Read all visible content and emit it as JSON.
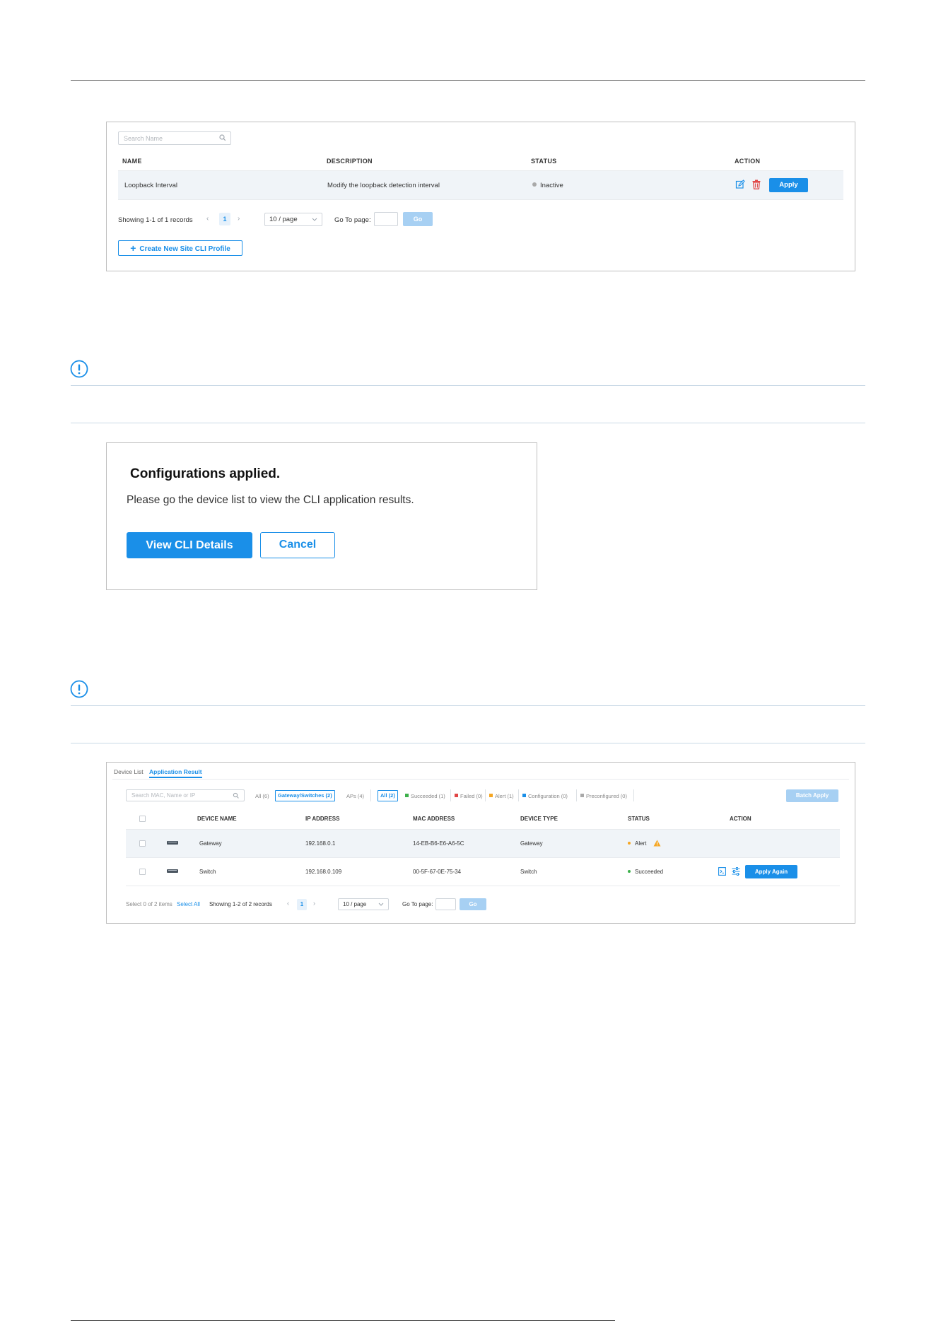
{
  "colors": {
    "accent": "#1a8fe8",
    "accent_light": "#a7d0f3",
    "danger": "#e14545",
    "success": "#3cb04a",
    "warning": "#f5a623",
    "inactive": "#a9a9a9",
    "configuration": "#1a8fe8"
  },
  "profiles_panel": {
    "search_placeholder": "Search Name",
    "columns": {
      "name": "NAME",
      "description": "DESCRIPTION",
      "status": "STATUS",
      "action": "ACTION"
    },
    "rows": [
      {
        "name": "Loopback Interval",
        "description": "Modify the loopback detection interval",
        "status": "Inactive",
        "apply_label": "Apply"
      }
    ],
    "pagination": {
      "showing": "Showing 1-1 of 1 records",
      "prev": "‹",
      "current_page": "1",
      "next": "›",
      "page_size": "10 / page",
      "goto_label": "Go To page:",
      "goto_value": "",
      "go_label": "Go"
    },
    "create_button": "Create New Site CLI Profile"
  },
  "dialog": {
    "title": "Configurations applied.",
    "message": "Please go the device list to view the CLI application results.",
    "primary_label": "View CLI Details",
    "secondary_label": "Cancel"
  },
  "results_panel": {
    "tabs": [
      "Device List",
      "Application Result"
    ],
    "active_tab": "Application Result",
    "search_placeholder": "Search MAC, Name or IP",
    "type_filters": [
      "All (6)",
      "Gateway/Switches (2)",
      "APs (4)"
    ],
    "status_filters": [
      {
        "label": "All (2)",
        "color": ""
      },
      {
        "label": "Succeeded (1)",
        "color": "#3cb04a"
      },
      {
        "label": "Failed (0)",
        "color": "#e14545"
      },
      {
        "label": "Alert (1)",
        "color": "#f5a623"
      },
      {
        "label": "Configuration (0)",
        "color": "#1a8fe8"
      },
      {
        "label": "Preconfigured (0)",
        "color": "#a9a9a9"
      }
    ],
    "batch_apply": "Batch Apply",
    "columns": {
      "device_name": "DEVICE NAME",
      "ip_address": "IP ADDRESS",
      "mac_address": "MAC ADDRESS",
      "device_type": "DEVICE TYPE",
      "status": "STATUS",
      "action": "ACTION"
    },
    "rows": [
      {
        "device_name": "Gateway",
        "ip": "192.168.0.1",
        "mac": "14-EB-B6-E6-A6-5C",
        "type": "Gateway",
        "status": "Alert",
        "status_color": "#f5a623"
      },
      {
        "device_name": "Switch",
        "ip": "192.168.0.109",
        "mac": "00-5F-67-0E-75-34",
        "type": "Switch",
        "status": "Succeeded",
        "status_color": "#3cb04a",
        "action_label": "Apply Again"
      }
    ],
    "footer": {
      "selected": "Select 0 of 2 items",
      "select_all": "Select All",
      "showing": "Showing 1-2 of 2 records",
      "prev": "‹",
      "current_page": "1",
      "next": "›",
      "page_size": "10 / page",
      "goto_label": "Go To page:",
      "go_label": "Go"
    }
  }
}
